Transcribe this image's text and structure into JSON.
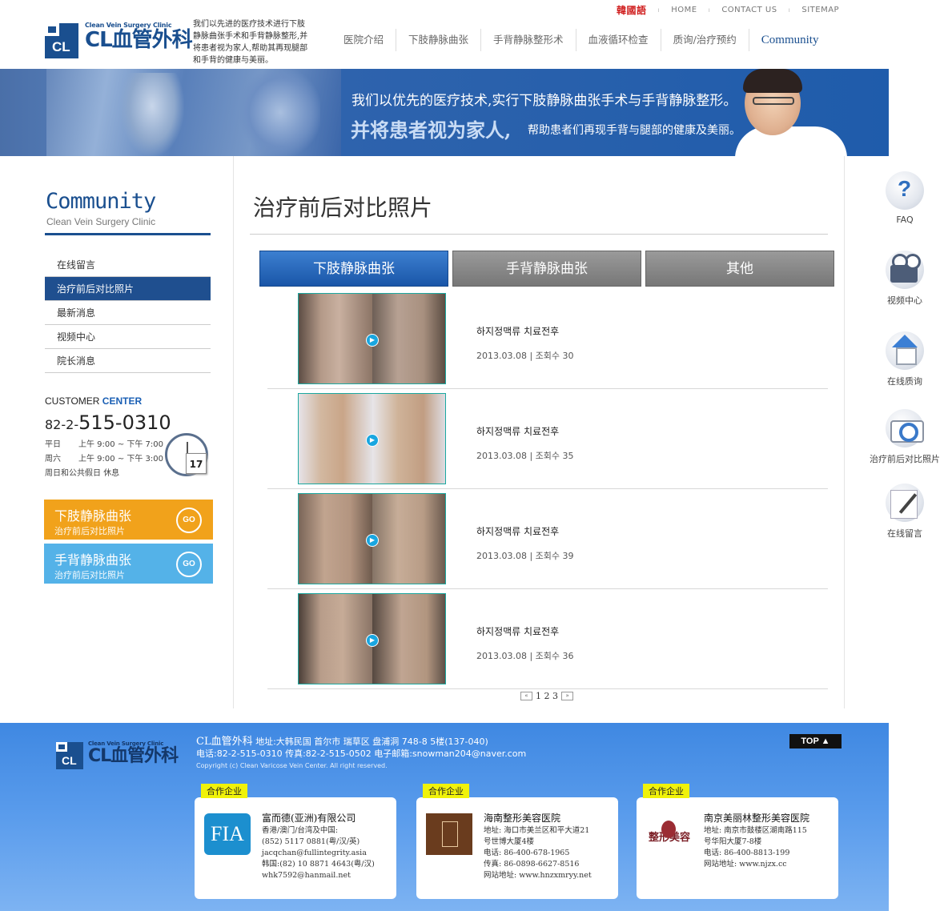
{
  "util": {
    "lang": "韓國語",
    "home": "HOME",
    "contact": "CONTACT US",
    "sitemap": "SITEMAP",
    "sep": "ı"
  },
  "logo": {
    "small": "Clean Vein Surgery Clinic",
    "big": "CL血管外科",
    "mark": "CL"
  },
  "logo_desc": "我们以先进的医疗技术进行下肢静脉曲张手术和手背静脉整形,并将患者视为家人,帮助其再现腿部和手背的健康与美丽。",
  "nav": [
    "医院介绍",
    "下肢静脉曲张",
    "手背静脉整形术",
    "血液循环检查",
    "质询/治疗预约",
    "Community"
  ],
  "banner": {
    "line1": "我们以优先的医疗技术,实行下肢静脉曲张手术与手背静脉整形。",
    "line2": "并将患者视为家人,",
    "line3": "帮助患者们再现手背与腿部的健康及美丽。"
  },
  "lnb": {
    "title": "Community",
    "subtitle": "Clean Vein Surgery Clinic",
    "items": [
      "在线留言",
      "治疗前后对比照片",
      "最新消息",
      "视频中心",
      "院长消息"
    ]
  },
  "customer": {
    "title_a": "CUSTOMER",
    "title_b": " CENTER",
    "phone_prefix": "82-2-",
    "phone": "515-0310",
    "hours": [
      {
        "day": "平日",
        "time": "上午 9:00 ~ 下午 7:00"
      },
      {
        "day": "周六",
        "time": "上午 9:00 ~ 下午 3:00"
      },
      {
        "day": "周日和公共假日",
        "time": "休息"
      }
    ],
    "cal_day": "17"
  },
  "go_buttons": [
    {
      "title": "下肢静脉曲张",
      "sub": "治疗前后对比照片",
      "go": "GO"
    },
    {
      "title": "手背静脉曲张",
      "sub": "治疗前后对比照片",
      "go": "GO"
    }
  ],
  "page_title": "治疗前后对比照片",
  "tabs": [
    "下肢静脉曲张",
    "手背静脉曲张",
    "其他"
  ],
  "posts": [
    {
      "title": "하지정맥류 치료전후",
      "meta": "2013.03.08 | 조회수 30"
    },
    {
      "title": "하지정맥류 치료전후",
      "meta": "2013.03.08 | 조회수 35"
    },
    {
      "title": "하지정맥류 치료전후",
      "meta": "2013.03.08 | 조회수 39"
    },
    {
      "title": "하지정맥류 치료전후",
      "meta": "2013.03.08 | 조회수 36"
    }
  ],
  "pager": {
    "prev": "«",
    "pages": "1 2 3",
    "next": "»"
  },
  "quick": [
    "FAQ",
    "视频中心",
    "在线质询",
    "治疗前后对比照片",
    "在线留言"
  ],
  "footer": {
    "name": "CL血管外科",
    "addr": "地址:大韩民国 首尔市 瑞草区 盘浦洞 748-8 5楼(137-040)",
    "contact": "电话:82-2-515-0310  传真:82-2-515-0502  电子邮箱:snowman204@naver.com",
    "copy": "Copyright (c) Clean Varicose Vein Center. All right reserved.",
    "top": "TOP ▲"
  },
  "partners": [
    {
      "tag": "合作企业",
      "logo": "FIA",
      "name": "富而德(亚洲)有限公司",
      "lines": [
        "香港/澳门/台湾及中国:",
        "(852) 5117 0881(粤/汉/英)",
        "jacqchan@fullintegrity.asia",
        "韩国:(82) 10 8871 4643(粤/汉)",
        "whk7592@hanmail.net"
      ]
    },
    {
      "tag": "合作企业",
      "logo": "",
      "name": "海南整形美容医院",
      "lines": [
        "地址: 海口市美兰区和平大道21",
        "      号世博大厦4楼",
        "电话: 86-400-678-1965",
        "传真: 86-0898-6627-8516",
        "网站地址: www.hnzxmryy.net"
      ]
    },
    {
      "tag": "合作企业",
      "logo": "整形美容",
      "name": "南京美丽林整形美容医院",
      "lines": [
        "地址: 南京市鼓楼区湖南路115",
        "      号华阳大厦7-8楼",
        "电话: 86-400-8813-199",
        "网站地址: www.njzx.cc"
      ]
    }
  ]
}
